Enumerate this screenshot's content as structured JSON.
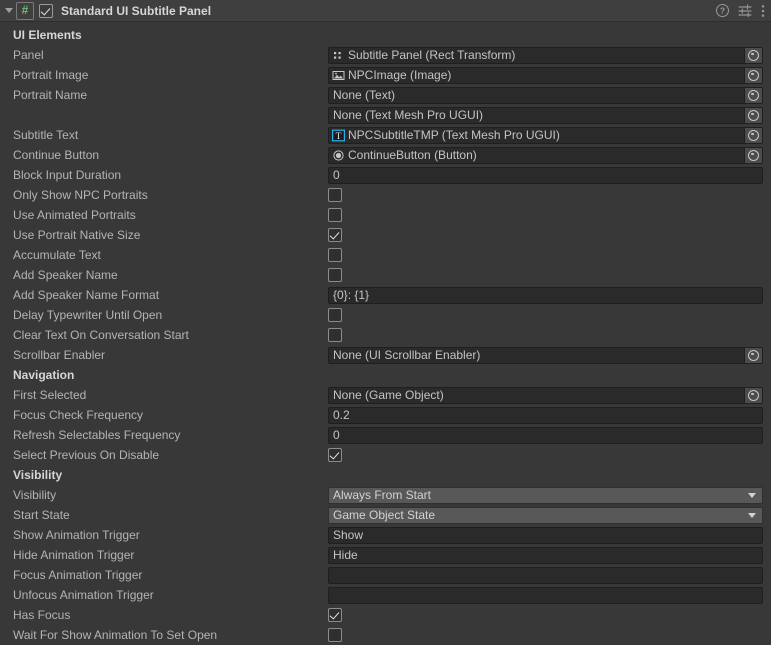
{
  "header": {
    "title": "Standard UI Subtitle Panel",
    "enabled": true,
    "foldout_icon": "foldout-triangle-icon",
    "script_icon": "script-hash-icon",
    "help_icon": "help-icon",
    "preset_icon": "preset-sliders-icon",
    "menu_icon": "kebab-menu-icon"
  },
  "rows": [
    {
      "kind": "section",
      "label": "UI Elements"
    },
    {
      "kind": "object",
      "label": "Panel",
      "value": "Subtitle Panel (Rect Transform)",
      "icon": "rect-transform-icon"
    },
    {
      "kind": "object",
      "label": "Portrait Image",
      "value": "NPCImage (Image)",
      "icon": "image-icon"
    },
    {
      "kind": "object",
      "label": "Portrait Name",
      "value": "None (Text)",
      "icon": "none-icon"
    },
    {
      "kind": "object",
      "label": "",
      "value": "None (Text Mesh Pro UGUI)",
      "icon": "none-icon"
    },
    {
      "kind": "object",
      "label": "Subtitle Text",
      "value": "NPCSubtitleTMP (Text Mesh Pro UGUI)",
      "icon": "tmp-text-icon"
    },
    {
      "kind": "object",
      "label": "Continue Button",
      "value": "ContinueButton (Button)",
      "icon": "button-icon"
    },
    {
      "kind": "text",
      "label": "Block Input Duration",
      "value": "0"
    },
    {
      "kind": "check",
      "label": "Only Show NPC Portraits",
      "value": false
    },
    {
      "kind": "check",
      "label": "Use Animated Portraits",
      "value": false
    },
    {
      "kind": "check",
      "label": "Use Portrait Native Size",
      "value": true
    },
    {
      "kind": "check",
      "label": "Accumulate Text",
      "value": false
    },
    {
      "kind": "check",
      "label": "Add Speaker Name",
      "value": false
    },
    {
      "kind": "text",
      "label": "Add Speaker Name Format",
      "value": "{0}: {1}"
    },
    {
      "kind": "check",
      "label": "Delay Typewriter Until Open",
      "value": false
    },
    {
      "kind": "check",
      "label": "Clear Text On Conversation Start",
      "value": false
    },
    {
      "kind": "object",
      "label": "Scrollbar Enabler",
      "value": "None (UI Scrollbar Enabler)",
      "icon": "none-icon"
    },
    {
      "kind": "section",
      "label": "Navigation"
    },
    {
      "kind": "object",
      "label": "First Selected",
      "value": "None (Game Object)",
      "icon": "none-icon"
    },
    {
      "kind": "text",
      "label": "Focus Check Frequency",
      "value": "0.2"
    },
    {
      "kind": "text",
      "label": "Refresh Selectables Frequency",
      "value": "0"
    },
    {
      "kind": "check",
      "label": "Select Previous On Disable",
      "value": true
    },
    {
      "kind": "section",
      "label": "Visibility"
    },
    {
      "kind": "dropdown",
      "label": "Visibility",
      "value": "Always From Start"
    },
    {
      "kind": "dropdown",
      "label": "Start State",
      "value": "Game Object State"
    },
    {
      "kind": "text",
      "label": "Show Animation Trigger",
      "value": "Show"
    },
    {
      "kind": "text",
      "label": "Hide Animation Trigger",
      "value": "Hide"
    },
    {
      "kind": "text",
      "label": "Focus Animation Trigger",
      "value": ""
    },
    {
      "kind": "text",
      "label": "Unfocus Animation Trigger",
      "value": ""
    },
    {
      "kind": "check",
      "label": "Has Focus",
      "value": true
    },
    {
      "kind": "check",
      "label": "Wait For Show Animation To Set Open",
      "value": false
    }
  ],
  "colors": {
    "panel_bg": "#383838",
    "header_bg": "#3f3f3f",
    "field_bg": "#2a2a2a",
    "dropdown_bg": "#585858",
    "label_text": "#b4b4b4",
    "accent_tmp": "#29b2e8",
    "script_green": "#6fbf73"
  }
}
